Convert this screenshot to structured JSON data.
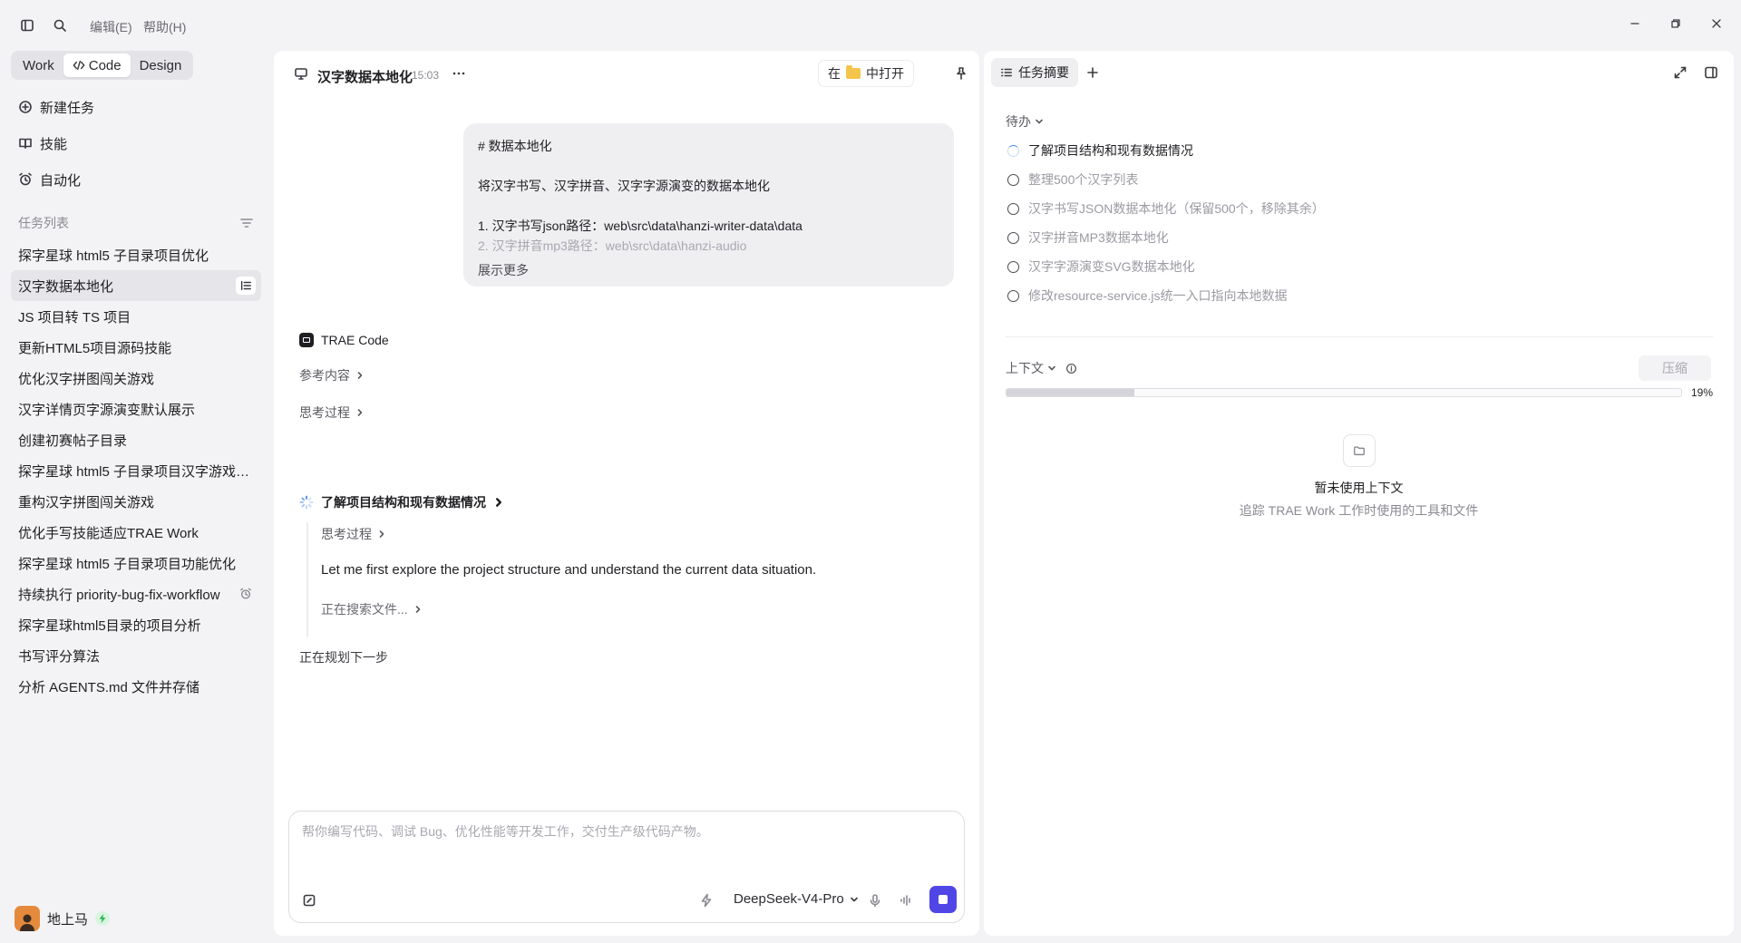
{
  "menu": {
    "edit": "编辑(E)",
    "help": "帮助(H)"
  },
  "modes": [
    {
      "label": "Work"
    },
    {
      "label": "Code",
      "active": true
    },
    {
      "label": "Design"
    }
  ],
  "nav": {
    "new_task": "新建任务",
    "skills": "技能",
    "automation": "自动化"
  },
  "task_section": "任务列表",
  "tasks": [
    "探字星球 html5 子目录项目优化",
    "汉字数据本地化",
    "JS 项目转 TS 项目",
    "更新HTML5项目源码技能",
    "优化汉字拼图闯关游戏",
    "汉字详情页字源演变默认展示",
    "创建初赛帖子目录",
    "探字星球 html5 子目录项目汉字游戏-汉字拼图闯关游戏",
    "重构汉字拼图闯关游戏",
    "优化手写技能适应TRAE Work",
    "探字星球 html5 子目录项目功能优化",
    "持续执行 priority-bug-fix-workflow",
    "探字星球html5目录的项目分析",
    "书写评分算法",
    "分析 AGENTS.md 文件并存储"
  ],
  "user": {
    "name": "地上马"
  },
  "chat": {
    "title": "汉字数据本地化",
    "time": "15:03",
    "open_in_prefix": "在",
    "open_in_suffix": "中打开",
    "user_message": {
      "line1": "# 数据本地化",
      "line2": "将汉字书写、汉字拼音、汉字字源演变的数据本地化",
      "line3": "1. 汉字书写json路径：web\\src\\data\\hanzi-writer-data\\data",
      "line4": "2. 汉字拼音mp3路径：web\\src\\data\\hanzi-audio",
      "show_more": "展示更多"
    },
    "agent_name": "TRAE Code",
    "reference": "参考内容",
    "thinking": "思考过程",
    "step_title": "了解项目结构和现有数据情况",
    "step_thinking": "思考过程",
    "step_text": "Let me first explore the project structure and understand the current data situation.",
    "searching": "正在搜索文件...",
    "planning": "正在规划下一步"
  },
  "composer": {
    "placeholder": "帮你编写代码、调试 Bug、优化性能等开发工作，交付生产级代码产物。",
    "model": "DeepSeek-V4-Pro"
  },
  "right_panel": {
    "tab": "任务摘要",
    "todo_section": "待办",
    "todos": [
      "了解项目结构和现有数据情况",
      "整理500个汉字列表",
      "汉字书写JSON数据本地化（保留500个，移除其余）",
      "汉字拼音MP3数据本地化",
      "汉字字源演变SVG数据本地化",
      "修改resource-service.js统一入口指向本地数据"
    ],
    "context_section": "上下文",
    "compress": "压缩",
    "context_percent": "19%",
    "context_fraction": 0.19,
    "empty_title": "暂未使用上下文",
    "empty_subtitle": "追踪 TRAE Work 工作时使用的工具和文件"
  },
  "colors": {
    "accent": "#4f46e5",
    "avatar": "#e58a3c",
    "folder": "#f4c54b",
    "spinner": "#4a8af4"
  }
}
